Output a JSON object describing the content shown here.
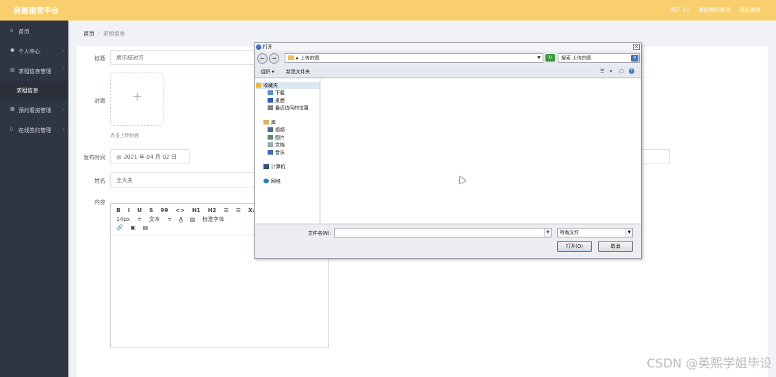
{
  "header": {
    "brand": "房屋租赁平台",
    "user_label": "用户 11",
    "profile_link": "退出我的账号",
    "logout_link": "退出登录"
  },
  "sidebar": {
    "items": [
      {
        "label": "首页",
        "icon": "home-icon"
      },
      {
        "label": "个人中心",
        "icon": "user-icon"
      },
      {
        "label": "求租信息管理",
        "icon": "list-icon"
      },
      {
        "label": "求租信息",
        "icon": ""
      },
      {
        "label": "预约看房管理",
        "icon": "calendar-icon"
      },
      {
        "label": "在线签约管理",
        "icon": "contract-icon"
      }
    ]
  },
  "breadcrumb": {
    "home": "首页",
    "separator": "/",
    "current": "求租信息"
  },
  "form": {
    "title_label": "标题",
    "title_value": "房乐结对方",
    "cover_label": "封面",
    "cover_plus": "+",
    "cover_hint": "点击上传封面",
    "date_label": "发布时间",
    "date_value": "2021 年 04 月 02 日",
    "name_label": "姓名",
    "name_value": "士大夫",
    "content_label": "内容"
  },
  "editor_toolbar": {
    "row1": [
      "B",
      "I",
      "U",
      "S",
      "99",
      "<>",
      "H1",
      "H2",
      "☰",
      "☰",
      "X₂",
      "X"
    ],
    "row2": [
      "14px",
      "≑",
      "文本",
      "≑",
      "A",
      "▧",
      "标准字体"
    ],
    "row3": [
      "🔗",
      "▣",
      "▤"
    ]
  },
  "dialog": {
    "title": "打开",
    "close": "×",
    "address": "上传的图",
    "search_placeholder": "搜索 上传的图",
    "cmd_organize": "组织 ▾",
    "cmd_newfolder": "新建文件夹",
    "nav": [
      {
        "label": "收藏夹",
        "icon": "star-icon",
        "color": "#f0b72f"
      },
      {
        "label": "下载",
        "icon": "download-icon",
        "color": "#5a8fd8"
      },
      {
        "label": "桌面",
        "icon": "desktop-icon",
        "color": "#2f5fb0"
      },
      {
        "label": "最近访问的位置",
        "icon": "recent-icon",
        "color": "#7c8494"
      },
      {
        "label": "库",
        "icon": "library-icon",
        "color": "#d9b45a"
      },
      {
        "label": "视频",
        "icon": "video-icon",
        "color": "#4a6b9a"
      },
      {
        "label": "图片",
        "icon": "picture-icon",
        "color": "#5f8f6a"
      },
      {
        "label": "文档",
        "icon": "document-icon",
        "color": "#a0a6b0"
      },
      {
        "label": "音乐",
        "icon": "music-icon",
        "color": "#3f6fb8"
      },
      {
        "label": "计算机",
        "icon": "computer-icon",
        "color": "#2f4f7f"
      },
      {
        "label": "网络",
        "icon": "network-icon",
        "color": "#2f7fb0"
      }
    ],
    "filename_label": "文件名(N):",
    "filetype_value": "所有文件",
    "open_button": "打开(O)",
    "cancel_button": "取消"
  },
  "watermark": "CSDN @英熙学姐毕设"
}
